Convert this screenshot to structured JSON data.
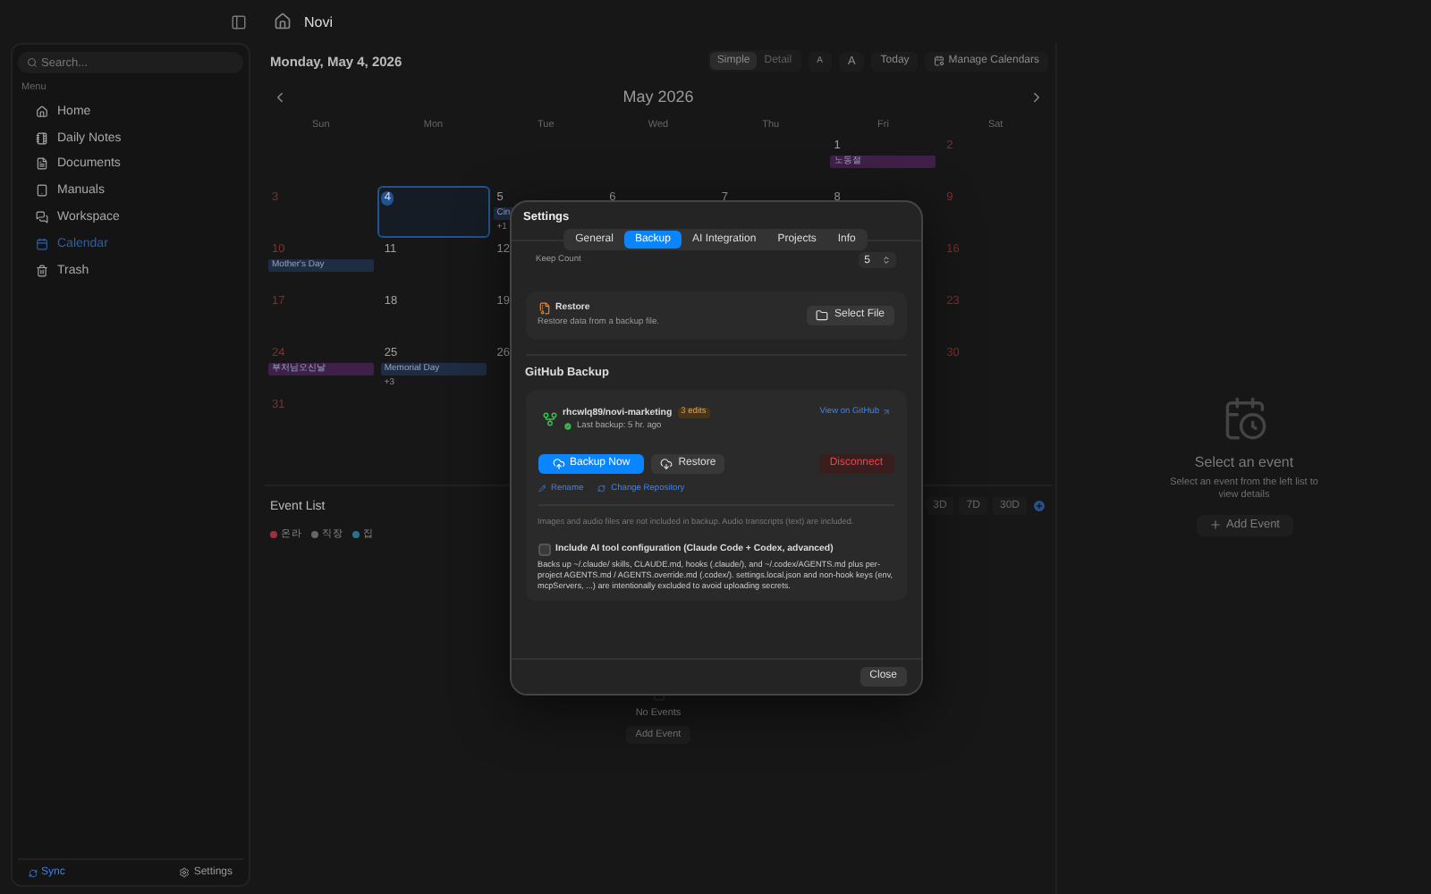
{
  "sidebar": {
    "search": {
      "placeholder": "Search..."
    },
    "section_label": "Menu",
    "items": [
      {
        "label": "Home",
        "selected": false
      },
      {
        "label": "Daily Notes",
        "selected": false
      },
      {
        "label": "Documents",
        "selected": false
      },
      {
        "label": "Manuals",
        "selected": false
      },
      {
        "label": "Workspace",
        "selected": false
      },
      {
        "label": "Calendar",
        "selected": true
      },
      {
        "label": "Trash",
        "selected": false
      }
    ],
    "sync": "Sync",
    "settings": "Settings"
  },
  "topbar": {
    "title": "Novi"
  },
  "calendar": {
    "date": "Monday, May 4, 2026",
    "view_options": [
      {
        "label": "Simple",
        "selected": true
      },
      {
        "label": "Detail",
        "selected": false
      }
    ],
    "font_buttons": [
      "A",
      "A"
    ],
    "today": "Today",
    "manage": "Manage Calendars",
    "month": "May 2026",
    "weekdays": [
      "Sun",
      "Mon",
      "Tue",
      "Wed",
      "Thu",
      "Fri",
      "Sat"
    ],
    "weeks": [
      {
        "to_saturday": [
          {
            "day": "1",
            "weekend": false,
            "today": false,
            "events": [
              {
                "label": "노동절",
                "color": "#3e2048"
              }
            ]
          },
          {
            "day": "2",
            "weekend": true,
            "today": false
          }
        ]
      },
      {
        "from_sunday": [
          {
            "day": "3",
            "weekend": true,
            "today": false
          },
          {
            "day": "4",
            "weekend": false,
            "today": true
          },
          {
            "day": "5",
            "weekend": false,
            "today": false,
            "events": [
              {
                "label": "Cin",
                "color": "#1e2c44"
              }
            ],
            "more": "+1"
          },
          {
            "day": "6",
            "weekend": false,
            "today": false
          },
          {
            "day": "7",
            "weekend": false,
            "today": false
          },
          {
            "day": "8",
            "weekend": false,
            "today": false
          },
          {
            "day": "9",
            "weekend": true,
            "today": false
          }
        ]
      },
      {
        "from_sunday": [
          {
            "day": "10",
            "weekend": true,
            "today": false,
            "events": [
              {
                "label": "Mother's Day",
                "color": "#1e2c44"
              }
            ]
          },
          {
            "day": "11",
            "weekend": false,
            "today": false
          },
          {
            "day": "12",
            "weekend": false,
            "today": false
          }
        ],
        "to_saturday": [
          {
            "day": "16",
            "weekend": true,
            "today": false
          }
        ]
      },
      {
        "from_sunday": [
          {
            "day": "17",
            "weekend": true,
            "today": false
          },
          {
            "day": "18",
            "weekend": false,
            "today": false
          },
          {
            "day": "19",
            "weekend": false,
            "today": false
          }
        ],
        "to_saturday": [
          {
            "day": "23",
            "weekend": true,
            "today": false
          }
        ]
      },
      {
        "from_sunday": [
          {
            "day": "24",
            "weekend": true,
            "today": false,
            "events": [
              {
                "label": "부처님오신날",
                "color": "#3e2048"
              }
            ]
          },
          {
            "day": "25",
            "weekend": false,
            "today": false,
            "events": [
              {
                "label": "Memorial Day",
                "color": "#1e2c44"
              }
            ],
            "more": "+3"
          },
          {
            "day": "26",
            "weekend": false,
            "today": false
          }
        ],
        "to_saturday": [
          {
            "day": "30",
            "weekend": true,
            "today": false
          }
        ]
      },
      {
        "from_sunday": [
          {
            "day": "31",
            "weekend": true,
            "today": false
          }
        ]
      }
    ]
  },
  "event_list": {
    "title": "Event List",
    "legend": [
      {
        "label": "온라",
        "color": "#a03040"
      },
      {
        "label": "직장",
        "color": "#666666"
      },
      {
        "label": "집",
        "color": "#2a7090"
      }
    ],
    "ranges": [
      {
        "label": "3D",
        "selected": false
      },
      {
        "label": "7D",
        "selected": false
      },
      {
        "label": "30D",
        "selected": false
      }
    ],
    "empty": "No Events",
    "add": "Add Event"
  },
  "detail": {
    "title": "Select an event",
    "hint": "Select an event from the left list to view details",
    "add": "Add Event"
  },
  "settings": {
    "title": "Settings",
    "tabs": [
      {
        "label": "General",
        "selected": false
      },
      {
        "label": "Backup",
        "selected": true
      },
      {
        "label": "AI Integration",
        "selected": false
      },
      {
        "label": "Projects",
        "selected": false
      },
      {
        "label": "Info",
        "selected": false
      }
    ],
    "keep_count": {
      "label": "Keep Count",
      "value": "5"
    },
    "restore": {
      "title": "Restore",
      "description": "Restore data from a backup file.",
      "button": "Select File"
    },
    "github": {
      "heading": "GitHub Backup",
      "repo": "rhcwlq89/novi-marketing",
      "badge": "3 edits",
      "last_backup": "Last backup: 5 hr. ago",
      "link": "View on GitHub",
      "backup_now": "Backup Now",
      "restore": "Restore",
      "disconnect": "Disconnect",
      "rename": "Rename",
      "change_repo": "Change Repository",
      "note": "Images and audio files are not included in backup. Audio transcripts (text) are included.",
      "ai_config": {
        "label": "Include AI tool configuration (Claude Code + Codex, advanced)",
        "checked": false,
        "description": "Backs up ~/.claude/ skills, CLAUDE.md, hooks (.claude/), and ~/.codex/AGENTS.md plus per-project AGENTS.md / AGENTS.override.md (.codex/). settings.local.json and non-hook keys (env, mcpServers, ...) are intentionally excluded to avoid uploading secrets."
      }
    },
    "close": "Close"
  }
}
